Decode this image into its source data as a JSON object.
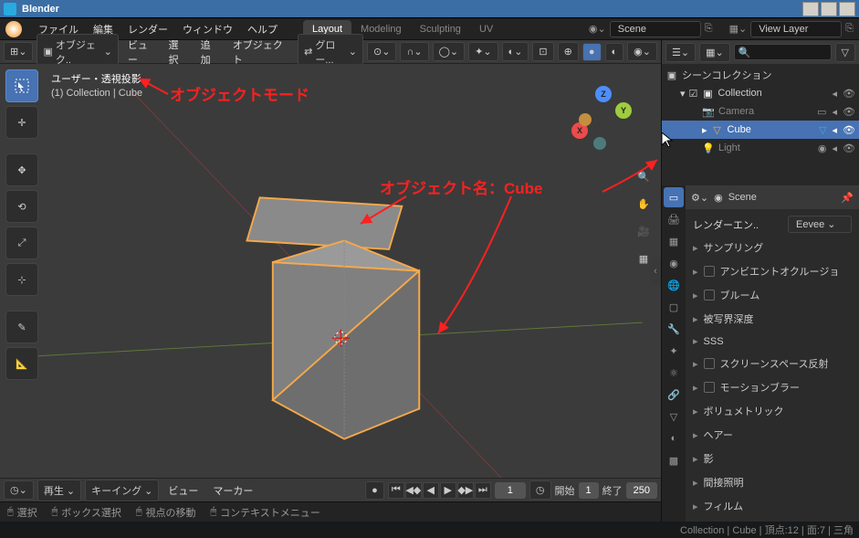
{
  "titlebar": {
    "title": "Blender"
  },
  "topmenu": {
    "items": [
      "ファイル",
      "編集",
      "レンダー",
      "ウィンドウ",
      "ヘルプ"
    ],
    "workspaces": [
      "Layout",
      "Modeling",
      "Sculpting",
      "UV"
    ],
    "active_workspace": 0,
    "scene_label": "Scene",
    "viewlayer_label": "View Layer"
  },
  "viewport_header": {
    "mode": "オブジェク..",
    "menus": [
      "ビュー",
      "選択",
      "追加",
      "オブジェクト"
    ],
    "orientation": "グロー..."
  },
  "viewport_info": {
    "line1": "ユーザー・透視投影",
    "line2": "(1) Collection | Cube"
  },
  "gizmo": {
    "x": "X",
    "y": "Y",
    "z": "Z"
  },
  "annotations": {
    "mode": "オブジェクトモード",
    "objname": "オブジェクト名：Cube"
  },
  "timeline": {
    "playback": "再生",
    "keying": "キーイング",
    "menus": [
      "ビュー",
      "マーカー"
    ],
    "current": "1",
    "start_label": "開始",
    "start": "1",
    "end_label": "終了",
    "end": "250"
  },
  "statusbar": {
    "items": [
      "選択",
      "ボックス選択",
      "視点の移動",
      "コンテキストメニュー"
    ],
    "right": "Collection | Cube | 頂点:12 | 面:7 | 三角"
  },
  "outliner": {
    "root": "シーンコレクション",
    "collection": "Collection",
    "items": [
      {
        "name": "Camera",
        "icon": "camera",
        "selected": false
      },
      {
        "name": "Cube",
        "icon": "mesh",
        "selected": true
      },
      {
        "name": "Light",
        "icon": "light",
        "selected": false
      }
    ]
  },
  "properties": {
    "scene": "Scene",
    "engine_label": "レンダーエン..",
    "engine_value": "Eevee",
    "panels": [
      {
        "label": "サンプリング",
        "check": false
      },
      {
        "label": "アンビエントオクルージョ",
        "check": true
      },
      {
        "label": "ブルーム",
        "check": true
      },
      {
        "label": "被写界深度",
        "check": false
      },
      {
        "label": "SSS",
        "check": false
      },
      {
        "label": "スクリーンスペース反射",
        "check": true
      },
      {
        "label": "モーションブラー",
        "check": true
      },
      {
        "label": "ボリュメトリック",
        "check": false
      },
      {
        "label": "ヘアー",
        "check": false
      },
      {
        "label": "影",
        "check": false
      },
      {
        "label": "間接照明",
        "check": false
      },
      {
        "label": "フィルム",
        "check": false
      }
    ]
  }
}
